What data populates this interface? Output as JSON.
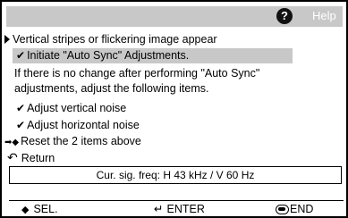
{
  "header": {
    "help_icon": "?",
    "help_label": "Help"
  },
  "menu": {
    "heading": "Vertical stripes or flickering image appear",
    "selected_item": "Initiate \"Auto Sync\" Adjustments.",
    "note_line1": "If there is no change after performing \"Auto Sync\"",
    "note_line2": "adjustments, adjust the following items.",
    "item_vertical": "Adjust vertical noise",
    "item_horizontal": "Adjust horizontal noise",
    "item_reset": "Reset the 2 items above",
    "return_label": "Return",
    "check_glyph": "✔",
    "reset_glyph": "➡◆",
    "return_glyph": "↶"
  },
  "status": {
    "frequency": "Cur. sig. freq: H 43 kHz / V 60 Hz"
  },
  "footer": {
    "sel_glyph": "◆",
    "sel_label": "SEL.",
    "enter_glyph": "↵",
    "enter_label": "ENTER",
    "end_label": "END"
  }
}
